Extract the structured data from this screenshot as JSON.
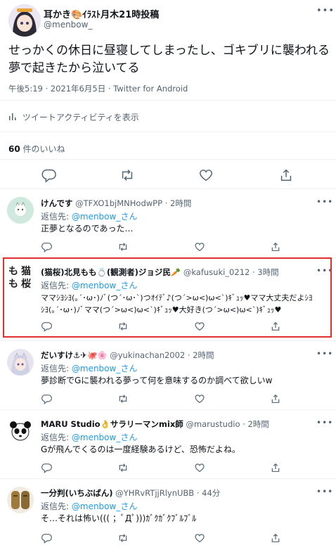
{
  "main_tweet": {
    "author_name": "耳かき🎨ｲﾗｽﾄ月木21時投稿",
    "handle": "@menbow_",
    "text": "せっかくの休日に昼寝してしまったし、ゴキブリに襲われる夢で起きたから泣いてる",
    "meta": "午後5:19 · 2021年6月5日 · Twitter for Android",
    "activity_label": "ツイートアクティビティを表示",
    "likes_count": "60",
    "likes_label": "件のいいね"
  },
  "replies": [
    {
      "name": "けんです",
      "handle": "@TFXO1bjMNHodwPP",
      "time": "2時間",
      "reply_to_prefix": "返信先:",
      "reply_to_handle": "@menbow_さん",
      "lines": [
        "正夢となるのであった…"
      ]
    },
    {
      "name": "(猫桜)北見もも💍(観測者)ジョジ民🥕",
      "handle": "@kafusuki_0212",
      "time": "3時間",
      "reply_to_prefix": "返信先:",
      "reply_to_handle": "@menbow_さん",
      "lines": [
        "ママｼﾖｼﾖ(｡´･ω･)ﾉﾞ(つ´･ω･`)つｵｲﾃﾞ♪(つ´>ω<)ω<`)ｷﾞｭｯ♥ママ大丈夫だよｼﾖ",
        "ｼﾖ(｡´･ω･)ﾉﾞママ(つ´>ω<)ω<`)ｷﾞｭｯ♥大好き(つ´>ω<)ω<`)ｷﾞｭｯ♥"
      ]
    },
    {
      "name": "だいすけ⚓✈🐙🌸",
      "handle": "@yukinachan2002",
      "time": "2時間",
      "reply_to_prefix": "返信先:",
      "reply_to_handle": "@menbow_さん",
      "lines": [
        "夢診断でGに襲われる夢って何を意味するのか調べて欲しいw"
      ]
    },
    {
      "name": "MARU Studio👌サラリーマンmix師",
      "handle": "@marustudio",
      "time": "2時間",
      "reply_to_prefix": "返信先:",
      "reply_to_handle": "@menbow_さん",
      "lines": [
        "Gが飛んでくるのは一度経験あるけど、恐怖だよね。"
      ]
    },
    {
      "name": "一分判(いちぶばん)",
      "handle": "@YHRvRTjjRlynUBB",
      "time": "44分",
      "reply_to_prefix": "返信先:",
      "reply_to_handle": "@menbow_さん",
      "lines": [
        "そ…それは怖い((( ；ﾟДﾟ)))ｶﾞｸｶﾞｸﾌﾞﾙﾌﾞﾙ"
      ]
    }
  ],
  "icons": {
    "reply": "reply-bubble-icon",
    "retweet": "retweet-icon",
    "like": "heart-icon",
    "share": "share-icon",
    "more": "more-dots-icon",
    "analytics": "analytics-bars-icon"
  },
  "colors": {
    "accent": "#1d9bf0",
    "secondary_text": "#536471",
    "divider": "#eff3f4",
    "highlight_border": "#e0302d"
  }
}
